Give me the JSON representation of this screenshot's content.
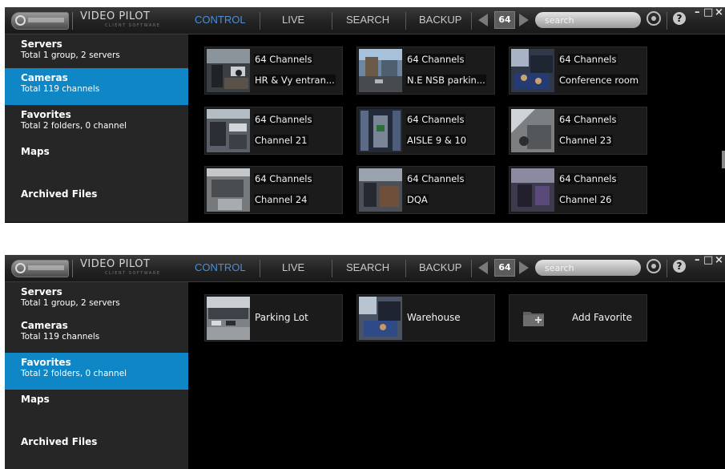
{
  "header": {
    "app_title": "VIDEO PILOT",
    "app_subtitle": "CLIENT SOFTWARE",
    "nav": [
      "CONTROL",
      "LIVE",
      "SEARCH",
      "BACKUP"
    ],
    "active_nav": "CONTROL",
    "grid_count": "64",
    "search_placeholder": "search",
    "help_label": "?",
    "minimize": "–",
    "maximize": "□",
    "close": "×"
  },
  "sidebar": [
    {
      "title": "Servers",
      "subtitle": "Total 1 group, 2 servers"
    },
    {
      "title": "Cameras",
      "subtitle": "Total 119 channels"
    },
    {
      "title": "Favorites",
      "subtitle": "Total 2 folders, 0 channel"
    },
    {
      "title": "Maps",
      "subtitle": ""
    },
    {
      "title": "Archived Files",
      "subtitle": ""
    }
  ],
  "cameras_view": {
    "active_sidebar": "Cameras",
    "tiles": [
      {
        "channels": "64 Channels",
        "name": "HR & Vy entran..."
      },
      {
        "channels": "64 Channels",
        "name": "N.E NSB parkin..."
      },
      {
        "channels": "64 Channels",
        "name": "Conference room"
      },
      {
        "channels": "64 Channels",
        "name": "Channel 21"
      },
      {
        "channels": "64 Channels",
        "name": "AISLE 9 & 10"
      },
      {
        "channels": "64 Channels",
        "name": "Channel 23"
      },
      {
        "channels": "64 Channels",
        "name": "Channel 24"
      },
      {
        "channels": "64 Channels",
        "name": "DQA"
      },
      {
        "channels": "64 Channels",
        "name": "Channel 26"
      }
    ]
  },
  "favorites_view": {
    "active_sidebar": "Favorites",
    "tiles": [
      {
        "name": "Parking Lot"
      },
      {
        "name": "Warehouse"
      }
    ],
    "add_label": "Add Favorite"
  },
  "colors": {
    "accent": "#0f86c6",
    "active_nav": "#4a8fd8",
    "sidebar_bg": "#262626",
    "tile_bg": "#1b1b1b",
    "background": "#000000"
  }
}
